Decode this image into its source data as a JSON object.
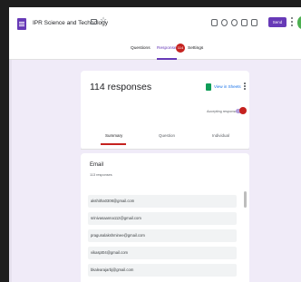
{
  "header": {
    "title": "IPR Science and Technology",
    "send_label": "Send"
  },
  "tabs": {
    "questions": "Questions",
    "responses": "Responses",
    "responses_count": "114",
    "settings": "Settings"
  },
  "summary_card": {
    "title": "114 responses",
    "view_in_sheets": "View in Sheets",
    "accepting_label": "Accepting responses",
    "sub_tabs": [
      "Summary",
      "Question",
      "Individual"
    ]
  },
  "question_card": {
    "title": "Email",
    "subtitle": "113 responses",
    "emails": [
      "akshitha0308@gmail.com",
      "srinivasaanna112@gmail.com",
      "pragunalakshminee@gmail.com",
      "vikaspt04@gmail.com",
      "bkalearajarbj@gmail.com"
    ]
  },
  "colors": {
    "accent": "#673ab7",
    "alert": "#c5221f",
    "background": "#f0ebf8"
  }
}
